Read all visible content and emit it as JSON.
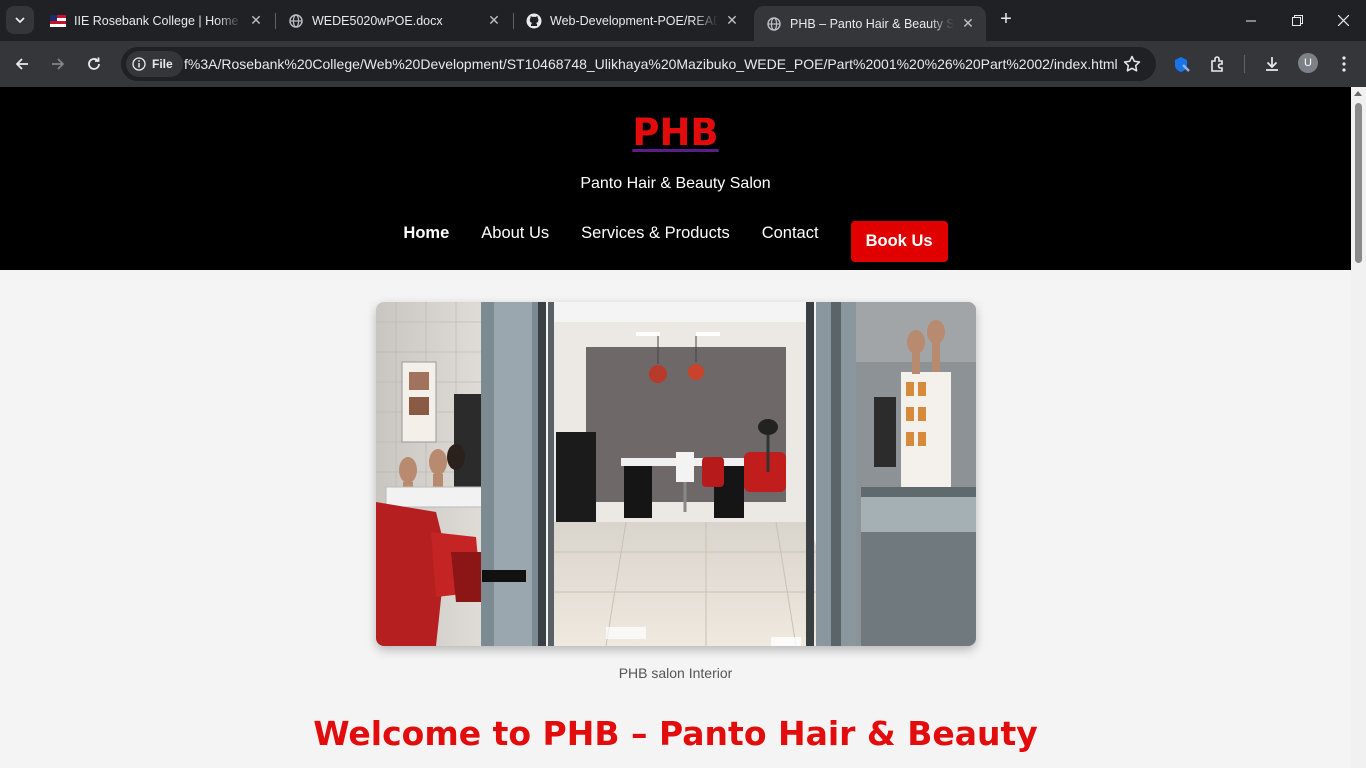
{
  "browser": {
    "tabs": [
      {
        "title": "IIE Rosebank College | Home - I",
        "icon": "iie-flag-icon"
      },
      {
        "title": "WEDE5020wPOE.docx",
        "icon": "globe-icon"
      },
      {
        "title": "Web-Development-POE/READM",
        "icon": "github-icon"
      },
      {
        "title": "PHB – Panto Hair & Beauty Salo",
        "icon": "globe-icon",
        "active": true
      }
    ],
    "chip_label": "File",
    "url": "f%3A/Rosebank%20College/Web%20Development/ST10468748_Ulikhaya%20Mazibuko_WEDE_POE/Part%2001%20%26%20Part%2002/index.html",
    "profile_initial": "U"
  },
  "site": {
    "logo": "PHB",
    "tagline": "Panto Hair & Beauty Salon",
    "nav": [
      {
        "label": "Home",
        "active": true
      },
      {
        "label": "About Us"
      },
      {
        "label": "Services & Products"
      },
      {
        "label": "Contact"
      }
    ],
    "cta": "Book Us",
    "hero_caption": "PHB salon Interior",
    "welcome_heading": "Welcome to PHB – Panto Hair & Beauty"
  },
  "colors": {
    "brand_red": "#e20c0c",
    "header_bg": "#000000",
    "page_bg": "#f4f4f4"
  }
}
